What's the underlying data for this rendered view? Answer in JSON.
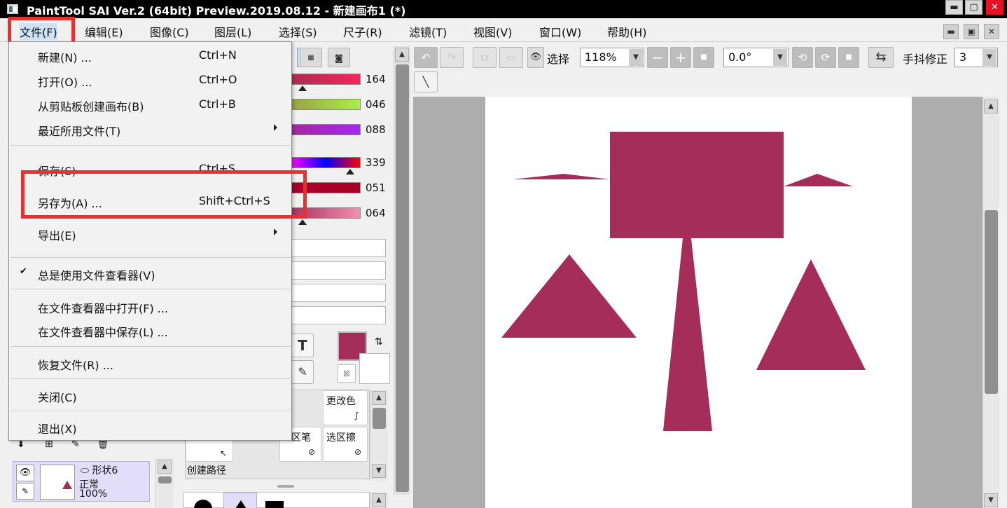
{
  "window": {
    "title": "PaintTool SAI Ver.2 (64bit) Preview.2019.08.12 - 新建画布1 (*)",
    "minimize_glyph": "▬",
    "maximize_glyph": "▢",
    "close_glyph": "✕"
  },
  "menubar": {
    "items": [
      "文件(F)",
      "编辑(E)",
      "图像(C)",
      "图层(L)",
      "选择(S)",
      "尺子(R)",
      "滤镜(T)",
      "视图(V)",
      "窗口(W)",
      "帮助(H)"
    ],
    "mdi_min": "▬",
    "mdi_restore": "▣",
    "mdi_close": "✕"
  },
  "file_menu": {
    "items": [
      {
        "label": "新建(N) ...",
        "shortcut": "Ctrl+N"
      },
      {
        "label": "打开(O) ...",
        "shortcut": "Ctrl+O"
      },
      {
        "label": "从剪贴板创建画布(B)",
        "shortcut": "Ctrl+B"
      },
      {
        "label": "最近所用文件(T)",
        "shortcut": ""
      },
      {
        "label": "保存(S)",
        "shortcut": "Ctrl+S"
      },
      {
        "label": "另存为(A) ...",
        "shortcut": "Shift+Ctrl+S"
      },
      {
        "label": "导出(E)",
        "shortcut": ""
      },
      {
        "label": "总是使用文件查看器(V)",
        "shortcut": ""
      },
      {
        "label": "在文件查看器中打开(F) ...",
        "shortcut": ""
      },
      {
        "label": "在文件查看器中保存(L) ...",
        "shortcut": ""
      },
      {
        "label": "恢复文件(R) ...",
        "shortcut": ""
      },
      {
        "label": "关闭(C)",
        "shortcut": ""
      },
      {
        "label": "退出(X)",
        "shortcut": ""
      }
    ],
    "checkmark": "✔"
  },
  "toolbar": {
    "select_label": "选择",
    "zoom_value": "118%",
    "rotation_value": "0.0°",
    "stabilizer_label": "手抖修正",
    "stabilizer_value": "3",
    "undo_glyph": "↶",
    "redo_glyph": "↷",
    "minus_glyph": "−",
    "plus_glyph": "+",
    "reset_glyph": "■",
    "rot_ccw_glyph": "⟲",
    "rot_cw_glyph": "⟳",
    "flip_glyph": "⇆",
    "line_glyph": "╲"
  },
  "color_sliders": {
    "rgb": [
      {
        "value": "164",
        "color_from": "#b02a55",
        "color_to": "#f4285a"
      },
      {
        "value": "046",
        "color_from": "#9aa246",
        "color_to": "#a8f046"
      },
      {
        "value": "088",
        "color_from": "#a428a0",
        "color_to": "#a428f0"
      }
    ],
    "hsv": [
      {
        "value": "339"
      },
      {
        "value": "051",
        "color_from": "#a8002a",
        "color_to": "#a80022"
      },
      {
        "value": "064",
        "color_from": "#b03060",
        "color_to": "#f090b0"
      }
    ],
    "current_color": "#a42e58"
  },
  "tools": {
    "text_tool_glyph": "T",
    "eyedropper_glyph": "✎",
    "change_color_label": "更改色",
    "marquee_pen_label": "区笔",
    "marquee_eraser_label": "选区擦",
    "create_path_label": "创建路径"
  },
  "layers": {
    "layer_name": "形状6",
    "blend_mode": "正常",
    "opacity": "100%"
  },
  "canvas": {
    "shape_color": "#a42e58"
  }
}
